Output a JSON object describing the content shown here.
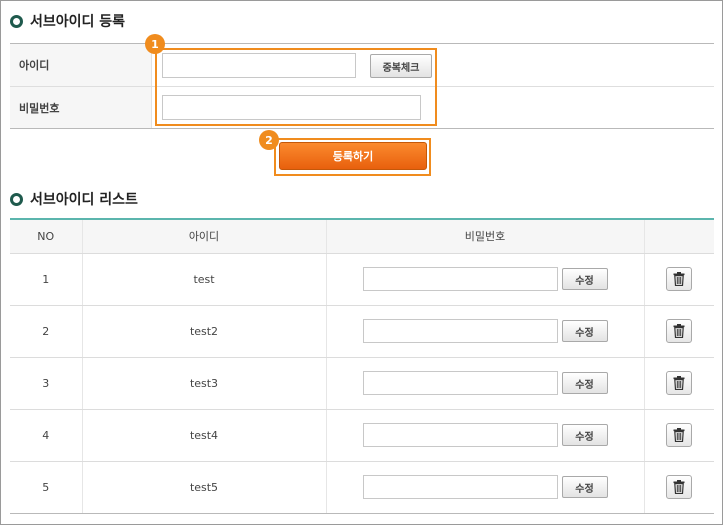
{
  "register_section": {
    "title": "서브아이디 등록",
    "id_label": "아이디",
    "password_label": "비밀번호",
    "id_value": "",
    "password_value": "",
    "duplicate_check_label": "중복체크",
    "register_button_label": "등록하기",
    "marker_1": "1",
    "marker_2": "2",
    "accent_color": "#f08c1e"
  },
  "list_section": {
    "title": "서브아이디 리스트",
    "columns": [
      "NO",
      "아이디",
      "비밀번호",
      ""
    ],
    "edit_label": "수정",
    "delete_icon": "trash-icon",
    "rows": [
      {
        "no": "1",
        "id": "test",
        "password": ""
      },
      {
        "no": "2",
        "id": "test2",
        "password": ""
      },
      {
        "no": "3",
        "id": "test3",
        "password": ""
      },
      {
        "no": "4",
        "id": "test4",
        "password": ""
      },
      {
        "no": "5",
        "id": "test5",
        "password": ""
      }
    ],
    "header_line_color": "#5bb5ad"
  }
}
